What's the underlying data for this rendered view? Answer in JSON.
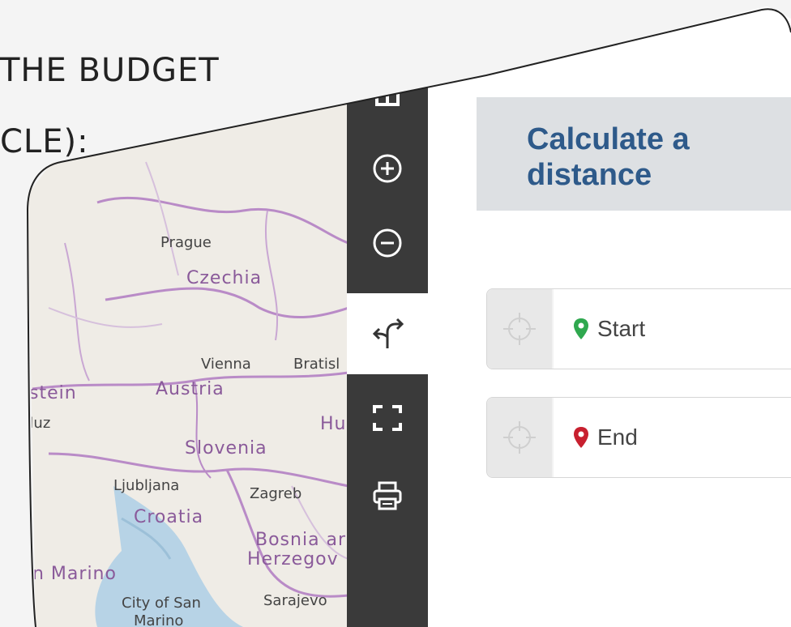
{
  "slide": {
    "line1": "THE BUDGET",
    "line2": "CLE):"
  },
  "toolbar": {
    "items": [
      {
        "name": "partial-icon",
        "glyph": "▯▯"
      },
      {
        "name": "zoom-in-icon",
        "glyph": "⊕"
      },
      {
        "name": "zoom-out-icon",
        "glyph": "⊖"
      },
      {
        "name": "route-icon",
        "glyph": "↰"
      },
      {
        "name": "fullscreen-icon",
        "glyph": "⛶"
      },
      {
        "name": "print-icon",
        "glyph": "🖶"
      }
    ]
  },
  "panel": {
    "title": "Calculate a distance",
    "start": {
      "label": "Start",
      "pin_color": "#2fa84f"
    },
    "end": {
      "label": "End",
      "pin_color": "#c8202f"
    }
  },
  "map": {
    "countries": [
      "Czechia",
      "Austria",
      "Slovenia",
      "Croatia",
      "Bosnia ar",
      "Herzegov"
    ],
    "cities": [
      "Prague",
      "Vienna",
      "Bratisl",
      "Ljubljana",
      "Zagreb",
      "City of San",
      "Marino",
      "Sarajevo"
    ],
    "partial_labels": [
      "stein",
      "duz",
      "Hu",
      "n Marino"
    ]
  }
}
